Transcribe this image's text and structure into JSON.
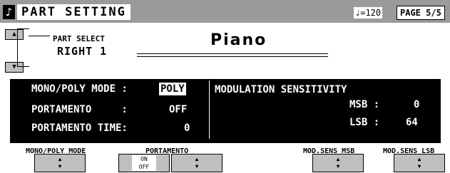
{
  "header": {
    "note_icon": "♪",
    "title": "PART SETTING",
    "tempo": "♩=120",
    "page": "PAGE 5/5"
  },
  "part_select": {
    "label": "PART SELECT",
    "value": "RIGHT 1",
    "voice": "Piano"
  },
  "params": {
    "mono_poly_label": "MONO/POLY MODE :",
    "mono_poly_value": "POLY",
    "portamento_label": "PORTAMENTO     :",
    "portamento_value": "OFF",
    "portamento_time_label": "PORTAMENTO TIME:",
    "portamento_time_value": "0",
    "mod_sens_title": "MODULATION SENSITIVITY",
    "msb_label": "MSB :",
    "msb_value": "0",
    "lsb_label": "LSB :",
    "lsb_value": "64"
  },
  "buttons": {
    "mono_poly_mode": "MONO/POLY MODE",
    "portamento": "PORTAMENTO",
    "on": "ON",
    "off": "OFF",
    "mod_sens_msb": "MOD.SENS MSB",
    "mod_sens_lsb": "MOD.SENS LSB"
  },
  "icons": {
    "up": "▲",
    "down": "▼"
  }
}
